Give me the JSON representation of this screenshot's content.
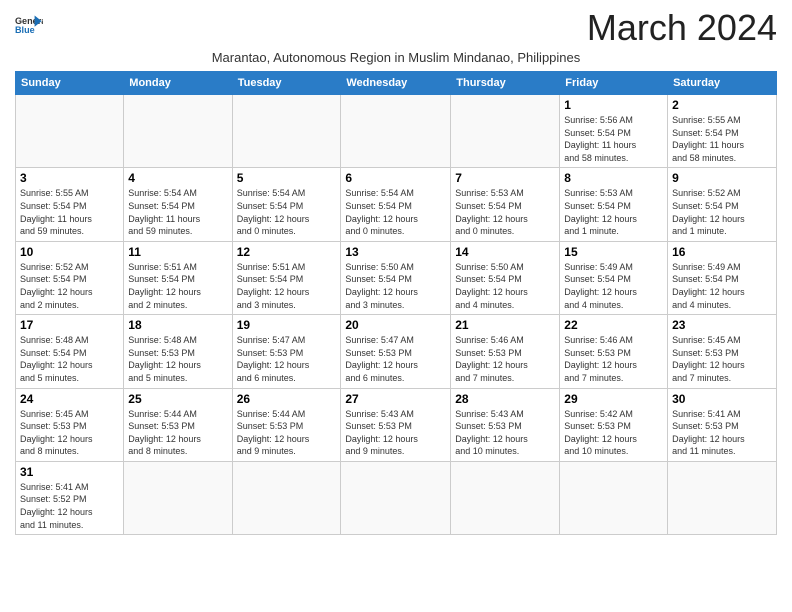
{
  "header": {
    "logo_line1": "General",
    "logo_line2": "Blue",
    "month_title": "March 2024",
    "subtitle": "Marantao, Autonomous Region in Muslim Mindanao, Philippines"
  },
  "weekdays": [
    "Sunday",
    "Monday",
    "Tuesday",
    "Wednesday",
    "Thursday",
    "Friday",
    "Saturday"
  ],
  "weeks": [
    [
      {
        "day": "",
        "info": ""
      },
      {
        "day": "",
        "info": ""
      },
      {
        "day": "",
        "info": ""
      },
      {
        "day": "",
        "info": ""
      },
      {
        "day": "",
        "info": ""
      },
      {
        "day": "1",
        "info": "Sunrise: 5:56 AM\nSunset: 5:54 PM\nDaylight: 11 hours\nand 58 minutes."
      },
      {
        "day": "2",
        "info": "Sunrise: 5:55 AM\nSunset: 5:54 PM\nDaylight: 11 hours\nand 58 minutes."
      }
    ],
    [
      {
        "day": "3",
        "info": "Sunrise: 5:55 AM\nSunset: 5:54 PM\nDaylight: 11 hours\nand 59 minutes."
      },
      {
        "day": "4",
        "info": "Sunrise: 5:54 AM\nSunset: 5:54 PM\nDaylight: 11 hours\nand 59 minutes."
      },
      {
        "day": "5",
        "info": "Sunrise: 5:54 AM\nSunset: 5:54 PM\nDaylight: 12 hours\nand 0 minutes."
      },
      {
        "day": "6",
        "info": "Sunrise: 5:54 AM\nSunset: 5:54 PM\nDaylight: 12 hours\nand 0 minutes."
      },
      {
        "day": "7",
        "info": "Sunrise: 5:53 AM\nSunset: 5:54 PM\nDaylight: 12 hours\nand 0 minutes."
      },
      {
        "day": "8",
        "info": "Sunrise: 5:53 AM\nSunset: 5:54 PM\nDaylight: 12 hours\nand 1 minute."
      },
      {
        "day": "9",
        "info": "Sunrise: 5:52 AM\nSunset: 5:54 PM\nDaylight: 12 hours\nand 1 minute."
      }
    ],
    [
      {
        "day": "10",
        "info": "Sunrise: 5:52 AM\nSunset: 5:54 PM\nDaylight: 12 hours\nand 2 minutes."
      },
      {
        "day": "11",
        "info": "Sunrise: 5:51 AM\nSunset: 5:54 PM\nDaylight: 12 hours\nand 2 minutes."
      },
      {
        "day": "12",
        "info": "Sunrise: 5:51 AM\nSunset: 5:54 PM\nDaylight: 12 hours\nand 3 minutes."
      },
      {
        "day": "13",
        "info": "Sunrise: 5:50 AM\nSunset: 5:54 PM\nDaylight: 12 hours\nand 3 minutes."
      },
      {
        "day": "14",
        "info": "Sunrise: 5:50 AM\nSunset: 5:54 PM\nDaylight: 12 hours\nand 4 minutes."
      },
      {
        "day": "15",
        "info": "Sunrise: 5:49 AM\nSunset: 5:54 PM\nDaylight: 12 hours\nand 4 minutes."
      },
      {
        "day": "16",
        "info": "Sunrise: 5:49 AM\nSunset: 5:54 PM\nDaylight: 12 hours\nand 4 minutes."
      }
    ],
    [
      {
        "day": "17",
        "info": "Sunrise: 5:48 AM\nSunset: 5:54 PM\nDaylight: 12 hours\nand 5 minutes."
      },
      {
        "day": "18",
        "info": "Sunrise: 5:48 AM\nSunset: 5:53 PM\nDaylight: 12 hours\nand 5 minutes."
      },
      {
        "day": "19",
        "info": "Sunrise: 5:47 AM\nSunset: 5:53 PM\nDaylight: 12 hours\nand 6 minutes."
      },
      {
        "day": "20",
        "info": "Sunrise: 5:47 AM\nSunset: 5:53 PM\nDaylight: 12 hours\nand 6 minutes."
      },
      {
        "day": "21",
        "info": "Sunrise: 5:46 AM\nSunset: 5:53 PM\nDaylight: 12 hours\nand 7 minutes."
      },
      {
        "day": "22",
        "info": "Sunrise: 5:46 AM\nSunset: 5:53 PM\nDaylight: 12 hours\nand 7 minutes."
      },
      {
        "day": "23",
        "info": "Sunrise: 5:45 AM\nSunset: 5:53 PM\nDaylight: 12 hours\nand 7 minutes."
      }
    ],
    [
      {
        "day": "24",
        "info": "Sunrise: 5:45 AM\nSunset: 5:53 PM\nDaylight: 12 hours\nand 8 minutes."
      },
      {
        "day": "25",
        "info": "Sunrise: 5:44 AM\nSunset: 5:53 PM\nDaylight: 12 hours\nand 8 minutes."
      },
      {
        "day": "26",
        "info": "Sunrise: 5:44 AM\nSunset: 5:53 PM\nDaylight: 12 hours\nand 9 minutes."
      },
      {
        "day": "27",
        "info": "Sunrise: 5:43 AM\nSunset: 5:53 PM\nDaylight: 12 hours\nand 9 minutes."
      },
      {
        "day": "28",
        "info": "Sunrise: 5:43 AM\nSunset: 5:53 PM\nDaylight: 12 hours\nand 10 minutes."
      },
      {
        "day": "29",
        "info": "Sunrise: 5:42 AM\nSunset: 5:53 PM\nDaylight: 12 hours\nand 10 minutes."
      },
      {
        "day": "30",
        "info": "Sunrise: 5:41 AM\nSunset: 5:53 PM\nDaylight: 12 hours\nand 11 minutes."
      }
    ],
    [
      {
        "day": "31",
        "info": "Sunrise: 5:41 AM\nSunset: 5:52 PM\nDaylight: 12 hours\nand 11 minutes."
      },
      {
        "day": "",
        "info": ""
      },
      {
        "day": "",
        "info": ""
      },
      {
        "day": "",
        "info": ""
      },
      {
        "day": "",
        "info": ""
      },
      {
        "day": "",
        "info": ""
      },
      {
        "day": "",
        "info": ""
      }
    ]
  ]
}
